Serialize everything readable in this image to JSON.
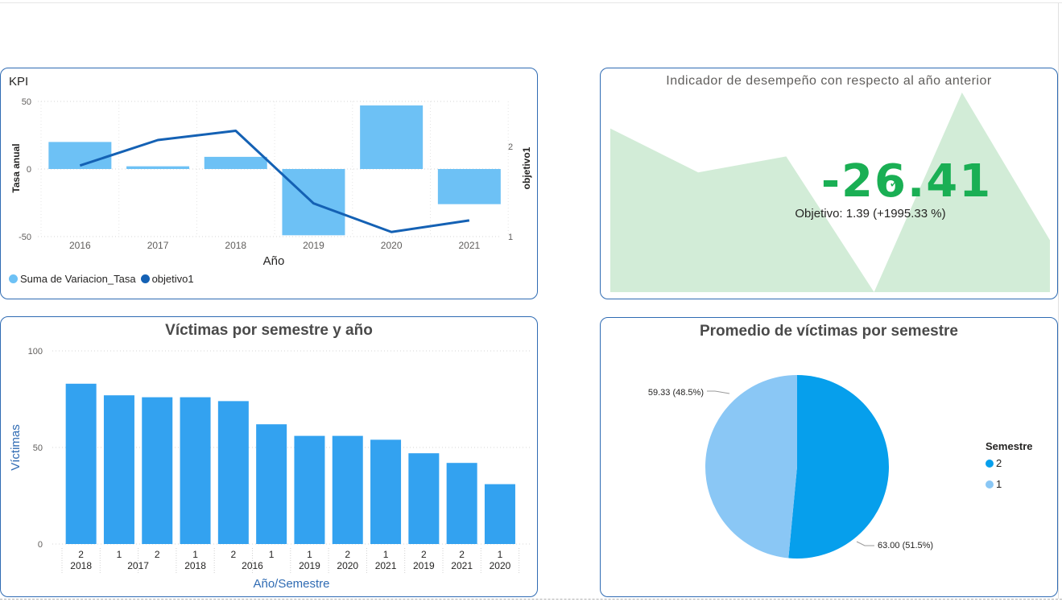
{
  "kpi": {
    "title": "KPI",
    "y_label": "Tasa anual",
    "y2_label": "objetivo1",
    "x_label": "Año",
    "legend": [
      "Suma de Variacion_Tasa",
      "objetivo1"
    ],
    "y_ticks": [
      "50",
      "0",
      "-50"
    ],
    "y2_ticks": [
      "2",
      "1"
    ]
  },
  "performance": {
    "title": "Indicador de desempeño con respecto al año anterior",
    "value": "-26.41",
    "goal_text": "Objetivo: 1.39 (+1995.33 %)",
    "check": "✓"
  },
  "victims": {
    "title": "Víctimas por semestre y año",
    "y_label": "Víctimas",
    "x_label": "Año/Semestre",
    "y_ticks": [
      "100",
      "50",
      "0"
    ]
  },
  "pie": {
    "title": "Promedio de víctimas por semestre",
    "legend_title": "Semestre",
    "label_a": "63.00 (51.5%)",
    "label_b": "59.33 (48.5%)"
  },
  "chart_data": [
    {
      "type": "bar",
      "title": "KPI",
      "categories": [
        "2016",
        "2017",
        "2018",
        "2019",
        "2020",
        "2021"
      ],
      "series": [
        {
          "name": "Suma de Variacion_Tasa",
          "values": [
            20,
            2,
            9,
            -49,
            47,
            -26
          ]
        },
        {
          "name": "objetivo1",
          "type": "line",
          "axis": "right",
          "values": [
            1.92,
            2.25,
            2.37,
            1.43,
            1.06,
            1.21
          ]
        }
      ],
      "xlabel": "Año",
      "ylabel": "Tasa anual",
      "y2label": "objetivo1",
      "ylim": [
        -50,
        50
      ],
      "y2lim": [
        1,
        2.75
      ],
      "colors": {
        "bars": "#6dc1f5",
        "line": "#1461b4"
      },
      "legend": "bottom-left"
    },
    {
      "type": "area",
      "title": "Indicador de desempeño con respecto al año anterior",
      "values": [
        0.82,
        0.6,
        0.68,
        0.0,
        1.0,
        0.26
      ],
      "color": "#d2ecd7"
    },
    {
      "type": "bar",
      "title": "Víctimas por semestre y año",
      "categories": [
        {
          "semester": "2",
          "year": "2018"
        },
        {
          "semester": "1",
          "year": "2017"
        },
        {
          "semester": "2",
          "year": "2017"
        },
        {
          "semester": "1",
          "year": "2018"
        },
        {
          "semester": "2",
          "year": "2016"
        },
        {
          "semester": "1",
          "year": "2016"
        },
        {
          "semester": "1",
          "year": "2019"
        },
        {
          "semester": "2",
          "year": "2020"
        },
        {
          "semester": "1",
          "year": "2021"
        },
        {
          "semester": "2",
          "year": "2019"
        },
        {
          "semester": "2",
          "year": "2021"
        },
        {
          "semester": "1",
          "year": "2020"
        }
      ],
      "year_labels": [
        "2018",
        "2017",
        "2018",
        "2016",
        "2019",
        "2020",
        "2021",
        "2019",
        "2021",
        "2020"
      ],
      "values": [
        83,
        77,
        76,
        76,
        74,
        62,
        56,
        56,
        54,
        47,
        42,
        31
      ],
      "xlabel": "Año/Semestre",
      "ylabel": "Víctimas",
      "ylim": [
        0,
        100
      ],
      "color": "#33a2f0"
    },
    {
      "type": "pie",
      "title": "Promedio de víctimas por semestre",
      "legend_title": "Semestre",
      "slices": [
        {
          "label": "2",
          "value": 63.0,
          "percent": 51.5,
          "color": "#069fec"
        },
        {
          "label": "1",
          "value": 59.33,
          "percent": 48.5,
          "color": "#8ac7f5"
        }
      ],
      "legend": "right"
    }
  ]
}
